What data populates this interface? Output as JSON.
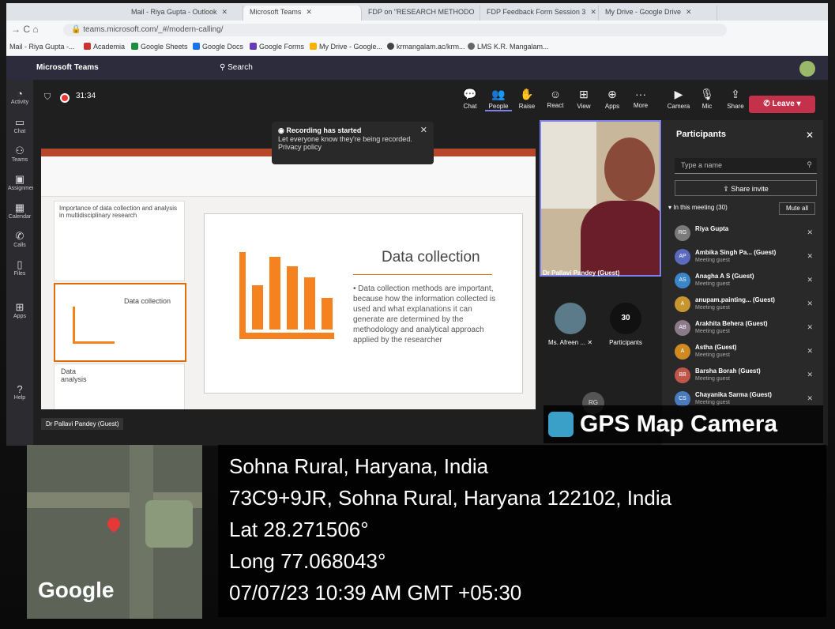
{
  "browser": {
    "tabs": [
      {
        "label": "Mail - Riya Gupta - Outlook"
      },
      {
        "label": "Microsoft Teams"
      },
      {
        "label": "FDP on \"RESEARCH METHODO"
      },
      {
        "label": "FDP Feedback Form Session 3"
      },
      {
        "label": "My Drive - Google Drive"
      }
    ],
    "url": "teams.microsoft.com/_#/modern-calling/",
    "bookmarks": [
      {
        "label": "Mail - Riya Gupta -..."
      },
      {
        "label": "Academia"
      },
      {
        "label": "Google Sheets"
      },
      {
        "label": "Google Docs"
      },
      {
        "label": "Google Forms"
      },
      {
        "label": "My Drive - Google..."
      },
      {
        "label": "krmangalam.ac/krm..."
      },
      {
        "label": "LMS K.R. Mangalam..."
      }
    ]
  },
  "teams": {
    "title": "Microsoft Teams",
    "search": "Search",
    "timer": "31:34",
    "rail": [
      "Activity",
      "Chat",
      "Teams",
      "Assignments",
      "Calendar",
      "Calls",
      "Files",
      "Apps",
      "Help"
    ],
    "call_buttons": [
      {
        "label": "Chat",
        "icon": "chat-icon"
      },
      {
        "label": "People",
        "icon": "people-icon"
      },
      {
        "label": "Raise",
        "icon": "hand-icon"
      },
      {
        "label": "React",
        "icon": "emoji-icon"
      },
      {
        "label": "View",
        "icon": "grid-icon"
      },
      {
        "label": "Apps",
        "icon": "apps-icon"
      },
      {
        "label": "More",
        "icon": "more-icon"
      },
      {
        "label": "Camera",
        "icon": "camera-icon"
      },
      {
        "label": "Mic",
        "icon": "mic-icon"
      },
      {
        "label": "Share",
        "icon": "share-icon"
      }
    ],
    "leave": "Leave",
    "toast": {
      "title": "Recording has started",
      "body": "Let everyone know they're being recorded.",
      "link": "Privacy policy"
    },
    "presenter_label": "Dr Pallavi Pandey (Guest)",
    "bottom_label": "Dr Pallavi Pandey (Guest)",
    "tiles": [
      {
        "label": "Ms. Afreen ..."
      },
      {
        "label": "Participants",
        "count": "30"
      }
    ],
    "tile_avatar": "RG"
  },
  "slides": {
    "thumb1_title": "Importance of data collection and analysis in multidisciplinary research",
    "thumb2_title": "Data collection",
    "thumb3_title": "Data analysis",
    "main_title": "Data collection",
    "main_body": "Data collection methods are important, because how the information collected is used and what explanations it can generate are determined by the methodology and analytical approach applied by the researcher"
  },
  "participants": {
    "title": "Participants",
    "search_placeholder": "Type a name",
    "share_invite": "Share invite",
    "in_meeting": "In this meeting (30)",
    "mute_all": "Mute all",
    "list": [
      {
        "initials": "RG",
        "name": "Riya Gupta",
        "role": "",
        "color": "#7a7a7a"
      },
      {
        "initials": "AP",
        "name": "Ambika Singh Pa... (Guest)",
        "role": "Meeting guest",
        "color": "#5b6abf"
      },
      {
        "initials": "AS",
        "name": "Anagha A S (Guest)",
        "role": "Meeting guest",
        "color": "#3a86c8"
      },
      {
        "initials": "A",
        "name": "anupam.painting... (Guest)",
        "role": "Meeting guest",
        "color": "#c8962e"
      },
      {
        "initials": "AB",
        "name": "Arakhita Behera (Guest)",
        "role": "Meeting guest",
        "color": "#8a7a8a"
      },
      {
        "initials": "A",
        "name": "Astha (Guest)",
        "role": "Meeting guest",
        "color": "#d08a22"
      },
      {
        "initials": "BB",
        "name": "Barsha Borah (Guest)",
        "role": "Meeting guest",
        "color": "#c2554a"
      },
      {
        "initials": "CS",
        "name": "Chayanika Sarma (Guest)",
        "role": "Meeting guest",
        "color": "#4a7bbf"
      }
    ]
  },
  "gps": {
    "badge": "GPS Map Camera",
    "map_brand": "Google",
    "lines": [
      "Sohna Rural, Haryana, India",
      "73C9+9JR, Sohna Rural, Haryana 122102, India",
      "Lat 28.271506°",
      "Long 77.068043°",
      "07/07/23 10:39 AM GMT +05:30"
    ]
  },
  "colors": {
    "accent": "#7b83eb",
    "leave": "#c4314b",
    "slide_orange": "#f5821f"
  }
}
